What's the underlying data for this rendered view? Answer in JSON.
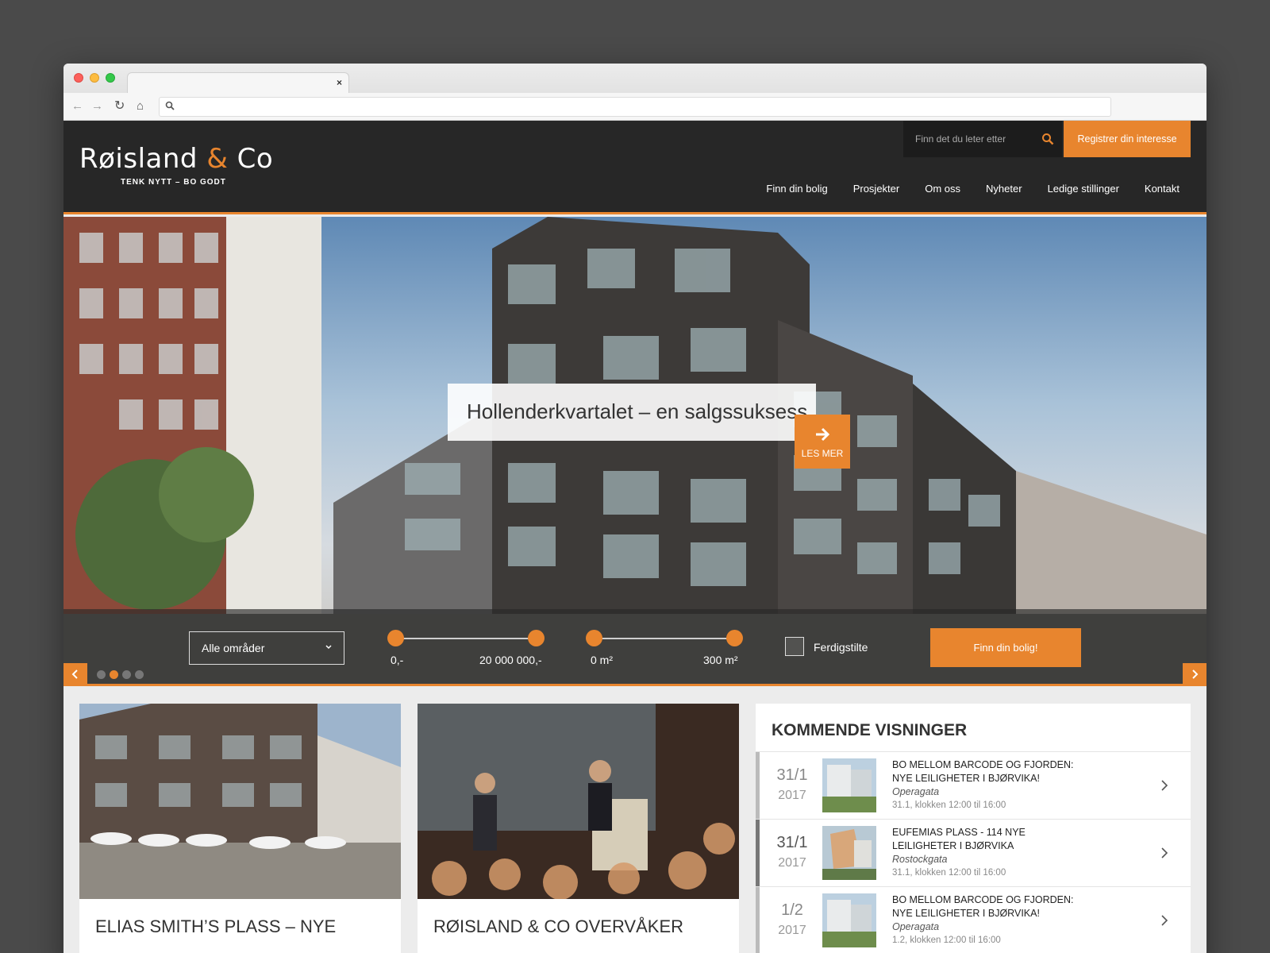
{
  "browser": {
    "tab_close": "×",
    "nav_back": "←",
    "nav_forward": "→",
    "nav_reload": "↻",
    "nav_home": "⌂"
  },
  "header": {
    "logo_main": "Røisland ",
    "logo_amp": "&",
    "logo_end": " Co",
    "tagline": "TENK NYTT – BO GODT",
    "search_placeholder": "Finn det du leter etter",
    "register_label": "Registrer din interesse",
    "nav": [
      "Finn din bolig",
      "Prosjekter",
      "Om oss",
      "Nyheter",
      "Ledige stillinger",
      "Kontakt"
    ]
  },
  "hero": {
    "title": "Hollenderkvartalet – en salgssuksess",
    "read_more": "LES MER",
    "slides_total": 4,
    "active_slide": 2
  },
  "filter": {
    "area_value": "Alle områder",
    "price_min": "0,-",
    "price_max": "20 000 000,-",
    "size_min": "0 m²",
    "size_max": "300 m²",
    "completed_label": "Ferdigstilte",
    "find_label": "Finn din bolig!"
  },
  "cards": [
    {
      "title": "ELIAS SMITH’S PLASS – NYE"
    },
    {
      "title": "RØISLAND & CO OVERVÅKER"
    }
  ],
  "visninger": {
    "title": "KOMMENDE VISNINGER",
    "items": [
      {
        "date": "31/1",
        "year": "2017",
        "title": "BO MELLOM BARCODE OG FJORDEN: NYE LEILIGHETER I BJØRVIKA!",
        "street": "Operagata",
        "time": "31.1, klokken 12:00 til 16:00"
      },
      {
        "date": "31/1",
        "year": "2017",
        "title": "EUFEMIAS PLASS - 114 NYE LEILIGHETER I BJØRVIKA",
        "street": "Rostockgata",
        "time": "31.1, klokken 12:00 til 16:00"
      },
      {
        "date": "1/2",
        "year": "2017",
        "title": "BO MELLOM BARCODE OG FJORDEN: NYE LEILIGHETER I BJØRVIKA!",
        "street": "Operagata",
        "time": "1.2, klokken 12:00 til 16:00"
      }
    ]
  },
  "colors": {
    "accent": "#e8852e",
    "header_bg": "#272727"
  }
}
